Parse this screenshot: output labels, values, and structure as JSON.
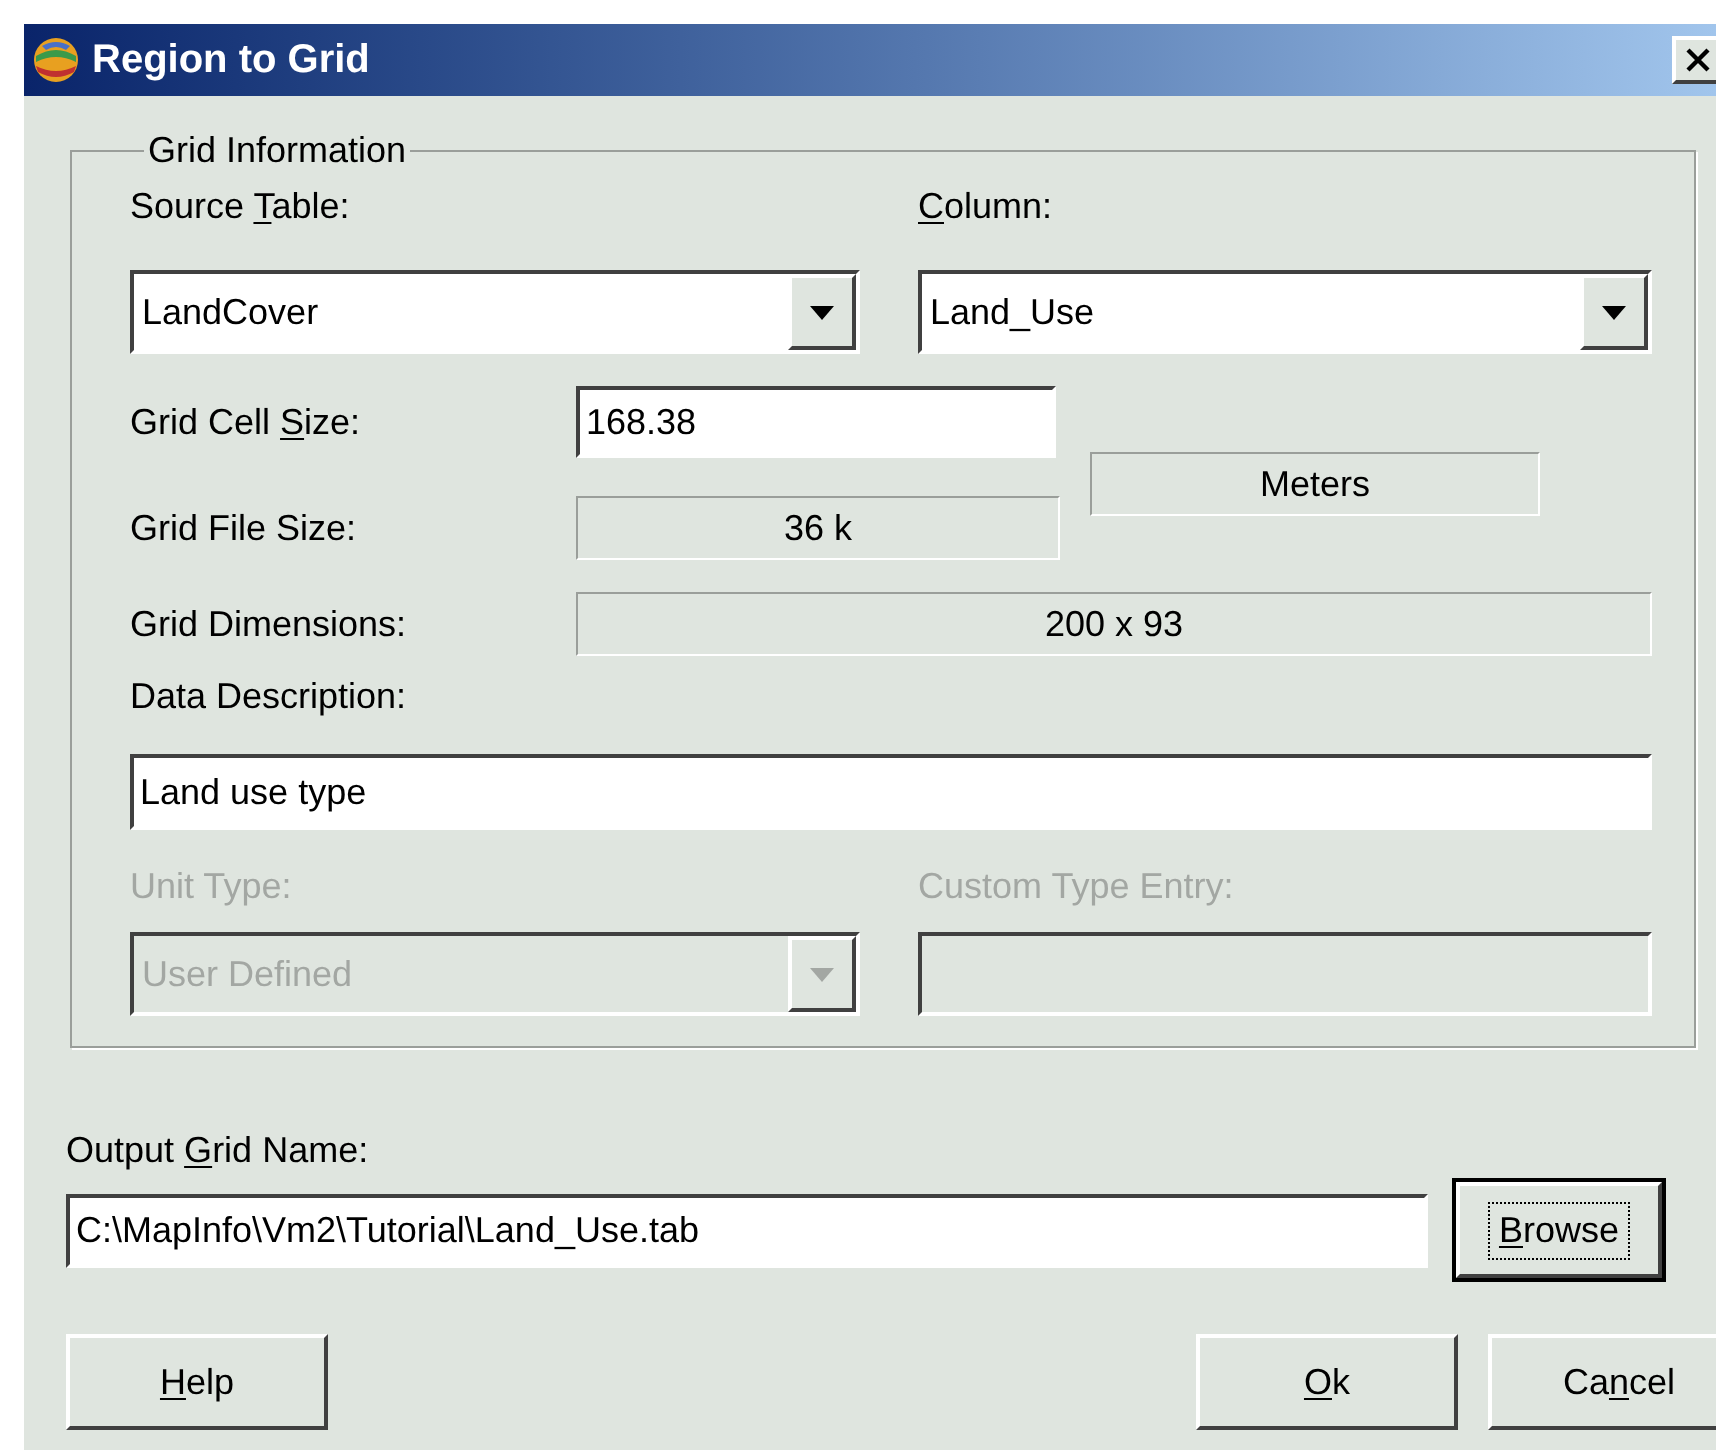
{
  "window": {
    "title": "Region to Grid"
  },
  "group": {
    "legend": "Grid Information"
  },
  "source_table": {
    "label": [
      {
        "text": "Source ",
        "underline": false
      },
      {
        "text": "T",
        "underline": true
      },
      {
        "text": "able:",
        "underline": false
      }
    ],
    "value": "LandCover",
    "disabled": false
  },
  "column": {
    "label": [
      {
        "text": "C",
        "underline": true
      },
      {
        "text": "olumn:",
        "underline": false
      }
    ],
    "value": "Land_Use",
    "disabled": false
  },
  "grid_cell_size": {
    "label": [
      {
        "text": "Grid Cell ",
        "underline": false
      },
      {
        "text": "S",
        "underline": true
      },
      {
        "text": "ize:",
        "underline": false
      }
    ],
    "value": "168.38"
  },
  "units": "Meters",
  "grid_file_size": {
    "label": "Grid File Size:",
    "value": "36 k"
  },
  "grid_dimensions": {
    "label": "Grid Dimensions:",
    "value": "200 x 93"
  },
  "data_description": {
    "label": "Data Description:",
    "value": "Land use type"
  },
  "unit_type": {
    "label": "Unit Type:",
    "value": "User Defined",
    "disabled": true
  },
  "custom_type_entry": {
    "label": "Custom Type Entry:",
    "disabled": true
  },
  "output_grid_name": {
    "label": [
      {
        "text": "Output ",
        "underline": false
      },
      {
        "text": "G",
        "underline": true
      },
      {
        "text": "rid Name:",
        "underline": false
      }
    ],
    "value": "C:\\MapInfo\\Vm2\\Tutorial\\Land_Use.tab"
  },
  "browse_button": {
    "label": [
      {
        "text": "B",
        "underline": true
      },
      {
        "text": "rowse",
        "underline": false
      }
    ],
    "default": true
  },
  "buttons": [
    {
      "label": [
        {
          "text": "H",
          "underline": true
        },
        {
          "text": "elp",
          "underline": false
        }
      ],
      "default": false
    },
    {
      "label": [
        {
          "text": "O",
          "underline": true
        },
        {
          "text": "k",
          "underline": false
        }
      ],
      "default": false
    },
    {
      "label": [
        {
          "text": "Ca",
          "underline": false
        },
        {
          "text": "n",
          "underline": true
        },
        {
          "text": "cel",
          "underline": false
        }
      ],
      "default": false
    }
  ]
}
